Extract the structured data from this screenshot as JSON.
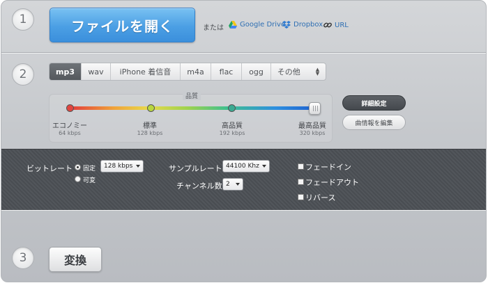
{
  "step1": {
    "number": "1",
    "open_button": "ファイルを開く",
    "or_text": "または",
    "sources": [
      {
        "label": "Google Drive",
        "icon": "google-drive-icon"
      },
      {
        "label": "Dropbox",
        "icon": "dropbox-icon"
      },
      {
        "label": "URL",
        "icon": "link-icon"
      }
    ]
  },
  "step2": {
    "number": "2",
    "formats": [
      "mp3",
      "wav",
      "iPhone 着信音",
      "m4a",
      "flac",
      "ogg",
      "その他"
    ],
    "selected_format": "mp3",
    "quality": {
      "title": "品質",
      "selected_index": 3,
      "levels": [
        {
          "label": "エコノミー",
          "bitrate": "64 kbps",
          "color": "#e0453f"
        },
        {
          "label": "標準",
          "bitrate": "128 kbps",
          "color": "#b8d63f"
        },
        {
          "label": "高品質",
          "bitrate": "192 kbps",
          "color": "#3aaa92"
        },
        {
          "label": "最高品質",
          "bitrate": "320 kbps",
          "color": "#2c63c9"
        }
      ]
    },
    "detail_button": "詳細設定",
    "tag_button": "曲情報を編集"
  },
  "settings": {
    "bitrate_label": "ビットレート",
    "bitrate_fixed": "固定",
    "bitrate_variable": "可変",
    "bitrate_mode": "固定",
    "bitrate_value": "128 kbps",
    "samplerate_label": "サンプルレート",
    "samplerate_value": "44100 Khz",
    "channels_label": "チャンネル数",
    "channels_value": "2",
    "fade_in": "フェードイン",
    "fade_out": "フェードアウト",
    "reverse": "リバース"
  },
  "step3": {
    "number": "3",
    "convert_button": "変換"
  },
  "colors": {
    "accent_blue": "#4b9fe4",
    "link_blue": "#2f6fb3",
    "panel_dark": "#4c5055"
  }
}
